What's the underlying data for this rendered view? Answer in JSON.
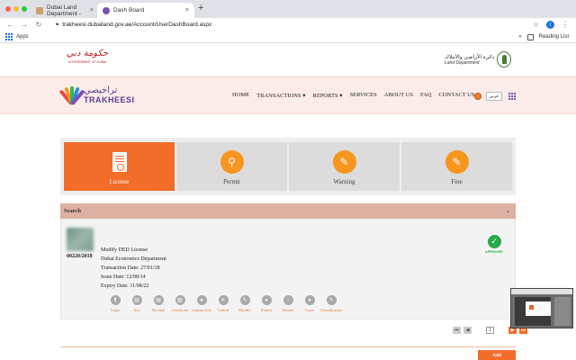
{
  "browser": {
    "tabs": [
      {
        "title": "Dubai Land Department -",
        "active": false
      },
      {
        "title": "Dash Board",
        "active": true
      }
    ],
    "url": "trakheesi.dubailand.gov.ae/Account/UserDashBoard.aspx",
    "profile_initial": "I",
    "bookmarks": {
      "apps": "Apps",
      "more": "»",
      "reading_list": "Reading List"
    }
  },
  "logos": {
    "gov_script": "حكومة دبي",
    "gov_sub": "GOVERNMENT OF DUBAI",
    "dld_ar": "دائرة الأراضي والأملاك",
    "dld_en": "Land Department"
  },
  "brand": {
    "ar": "تراخيصي",
    "en": "TRAKHEESI"
  },
  "nav": {
    "items": [
      "HOME",
      "TRANSACTIONS ▾",
      "REPORTS ▾",
      "SERVICES",
      "ABOUT US",
      "FAQ",
      "CONTACT US"
    ],
    "language": "عربي"
  },
  "categories": [
    {
      "label": "License",
      "icon": "license-icon",
      "active": true
    },
    {
      "label": "Permit",
      "icon": "stamp-icon",
      "active": false
    },
    {
      "label": "Warning",
      "icon": "edit-icon",
      "active": false
    },
    {
      "label": "Fine",
      "icon": "edit-icon",
      "active": false
    }
  ],
  "search": {
    "label": "Search",
    "chevron": "⌄"
  },
  "license": {
    "id": "00220/2018",
    "title": "Modify DED License",
    "department": "Dubai Economics Department",
    "transaction_date": "Transaction Date: 27/01/18",
    "issue_date": "Issue Date: 12/08/14",
    "expiry_date": "Expiry Date: 11/08/22",
    "status": "APPROVED"
  },
  "actions": [
    {
      "label": "Logo",
      "glyph": "⬆"
    },
    {
      "label": "Noc",
      "glyph": "▤"
    },
    {
      "label": "Receipt",
      "glyph": "▤"
    },
    {
      "label": "Certificate",
      "glyph": "▤"
    },
    {
      "label": "Contact Info",
      "glyph": "●"
    },
    {
      "label": "Cancel",
      "glyph": "✕"
    },
    {
      "label": "Modify",
      "glyph": "✎"
    },
    {
      "label": "Permit",
      "glyph": "●"
    },
    {
      "label": "Details",
      "glyph": "i"
    },
    {
      "label": "Cases",
      "glyph": "●"
    },
    {
      "label": "Classification",
      "glyph": "✎"
    }
  ],
  "pager": {
    "first": "⏮",
    "prev": "◀",
    "current": "1",
    "next": "▶",
    "last": "⏭"
  },
  "add_label": "Add",
  "colors": {
    "accent": "#f26c2a",
    "approved": "#2aa84a",
    "header_band": "#fbecea"
  }
}
